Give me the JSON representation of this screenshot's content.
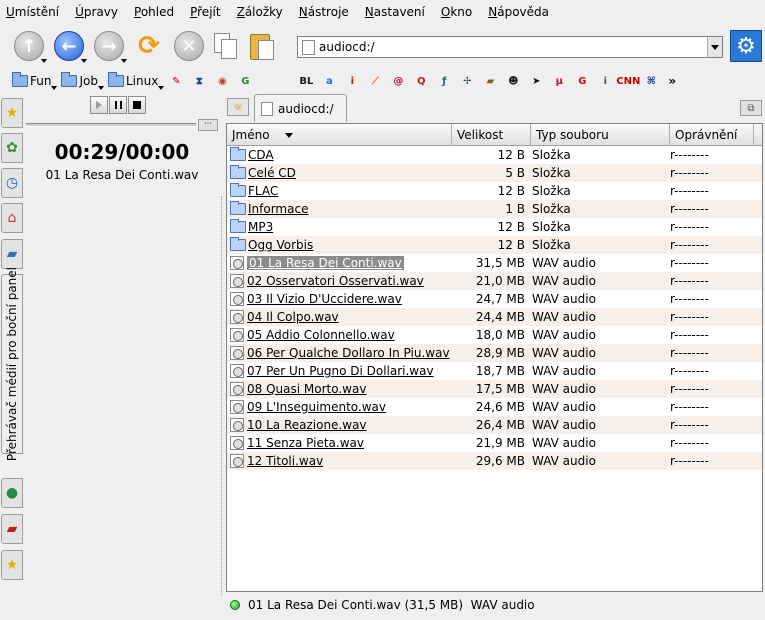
{
  "menubar": {
    "items": [
      "Umístění",
      "Úpravy",
      "Pohled",
      "Přejít",
      "Záložky",
      "Nástroje",
      "Nastavení",
      "Okno",
      "Nápověda"
    ]
  },
  "toolbar": {
    "buttons": [
      "up-arrow-icon",
      "back-arrow-icon",
      "forward-arrow-icon",
      "reload-icon",
      "stop-icon",
      "copy-icon",
      "paste-icon"
    ],
    "location_value": "audiocd:/",
    "accent": "#2b7ad6"
  },
  "bookmarks": {
    "folders": [
      {
        "label": "Fun"
      },
      {
        "label": "Job"
      },
      {
        "label": "Linux"
      }
    ],
    "favicons": [
      {
        "name": "pen-favicon",
        "glyph": "✎",
        "color": "#c00000"
      },
      {
        "name": "bookmark-favicon",
        "glyph": "⧗",
        "color": "#1f3fa0"
      },
      {
        "name": "target-favicon",
        "glyph": "◉",
        "color": "#c0392b"
      },
      {
        "name": "g-favicon",
        "glyph": "G",
        "color": "#2a8a3a"
      },
      {
        "name": "bl-favicon",
        "glyph": "BL",
        "color": "#1a1a1a"
      },
      {
        "name": "a-favicon",
        "glyph": "a",
        "color": "#2a6fd6"
      },
      {
        "name": "info-favicon",
        "glyph": "i",
        "color": "#d01010"
      },
      {
        "name": "slashdot-favicon",
        "glyph": "⟋",
        "color": "#ff5a1a"
      },
      {
        "name": "debian-favicon",
        "glyph": "@",
        "color": "#c8003c"
      },
      {
        "name": "search-favicon",
        "glyph": "Q",
        "color": "#cc1a1a"
      },
      {
        "name": "script-favicon",
        "glyph": "ƒ",
        "color": "#1f6f6f"
      },
      {
        "name": "globe-favicon",
        "glyph": "✢",
        "color": "#1a4f8a"
      },
      {
        "name": "folder-favicon",
        "glyph": "▰",
        "color": "#8a5a1a"
      },
      {
        "name": "chat-favicon",
        "glyph": "☻",
        "color": "#1a1a1a"
      },
      {
        "name": "arrow-favicon",
        "glyph": "➤",
        "color": "#111111"
      },
      {
        "name": "mu-favicon",
        "glyph": "μ",
        "color": "#cc1010"
      },
      {
        "name": "gg-favicon",
        "glyph": "G",
        "color": "#cc1010"
      },
      {
        "name": "letter-favicon",
        "glyph": "i",
        "color": "#555555"
      },
      {
        "name": "cnn-favicon",
        "glyph": "CNN",
        "color": "#cc0000"
      },
      {
        "name": "link-favicon",
        "glyph": "⌘",
        "color": "#1a3f8a"
      }
    ],
    "more": "»"
  },
  "sidepanel": {
    "tabs": [
      "star-icon",
      "network-icon",
      "history-icon",
      "home-icon",
      "folder-icon",
      "media-icon",
      "globe-icon",
      "red-folder-icon",
      "star-icon"
    ],
    "media_tab_label": "Přehrávač médií pro boční panel"
  },
  "media": {
    "time": "00:29/00:00",
    "file": "01 La Resa Dei Conti.wav",
    "slider_btn": "···"
  },
  "tabs": {
    "active_label": "audiocd:/"
  },
  "fileview": {
    "columns": [
      "Jméno",
      "Velikost",
      "Typ souboru",
      "Oprávnění"
    ],
    "rows": [
      {
        "name": "CDA",
        "size": "12 B",
        "type": "Složka",
        "perm": "r--------",
        "kind": "folder"
      },
      {
        "name": "Celé CD",
        "size": "5 B",
        "type": "Složka",
        "perm": "r--------",
        "kind": "folder"
      },
      {
        "name": "FLAC",
        "size": "12 B",
        "type": "Složka",
        "perm": "r--------",
        "kind": "folder"
      },
      {
        "name": "Informace",
        "size": "1 B",
        "type": "Složka",
        "perm": "r--------",
        "kind": "folder"
      },
      {
        "name": "MP3",
        "size": "12 B",
        "type": "Složka",
        "perm": "r--------",
        "kind": "folder"
      },
      {
        "name": "Ogg Vorbis",
        "size": "12 B",
        "type": "Složka",
        "perm": "r--------",
        "kind": "folder"
      },
      {
        "name": "01 La Resa Dei Conti.wav",
        "size": "31,5 MB",
        "type": "WAV audio",
        "perm": "r--------",
        "kind": "audio",
        "selected": true
      },
      {
        "name": "02 Osservatori Osservati.wav",
        "size": "21,0 MB",
        "type": "WAV audio",
        "perm": "r--------",
        "kind": "audio"
      },
      {
        "name": "03 Il Vizio D'Uccidere.wav",
        "size": "24,7 MB",
        "type": "WAV audio",
        "perm": "r--------",
        "kind": "audio"
      },
      {
        "name": "04 Il Colpo.wav",
        "size": "24,4 MB",
        "type": "WAV audio",
        "perm": "r--------",
        "kind": "audio"
      },
      {
        "name": "05 Addio Colonnello.wav",
        "size": "18,0 MB",
        "type": "WAV audio",
        "perm": "r--------",
        "kind": "audio"
      },
      {
        "name": "06 Per Qualche Dollaro In Piu.wav",
        "size": "28,9 MB",
        "type": "WAV audio",
        "perm": "r--------",
        "kind": "audio"
      },
      {
        "name": "07 Per Un Pugno Di Dollari.wav",
        "size": "18,7 MB",
        "type": "WAV audio",
        "perm": "r--------",
        "kind": "audio"
      },
      {
        "name": "08 Quasi Morto.wav",
        "size": "17,5 MB",
        "type": "WAV audio",
        "perm": "r--------",
        "kind": "audio"
      },
      {
        "name": "09 L'Inseguimento.wav",
        "size": "24,6 MB",
        "type": "WAV audio",
        "perm": "r--------",
        "kind": "audio"
      },
      {
        "name": "10 La Reazione.wav",
        "size": "26,4 MB",
        "type": "WAV audio",
        "perm": "r--------",
        "kind": "audio"
      },
      {
        "name": "11 Senza Pieta.wav",
        "size": "21,9 MB",
        "type": "WAV audio",
        "perm": "r--------",
        "kind": "audio"
      },
      {
        "name": "12 Titoli.wav",
        "size": "29,6 MB",
        "type": "WAV audio",
        "perm": "r--------",
        "kind": "audio"
      }
    ]
  },
  "status": {
    "text": "01 La Resa Dei Conti.wav (31,5 MB)  WAV audio"
  }
}
